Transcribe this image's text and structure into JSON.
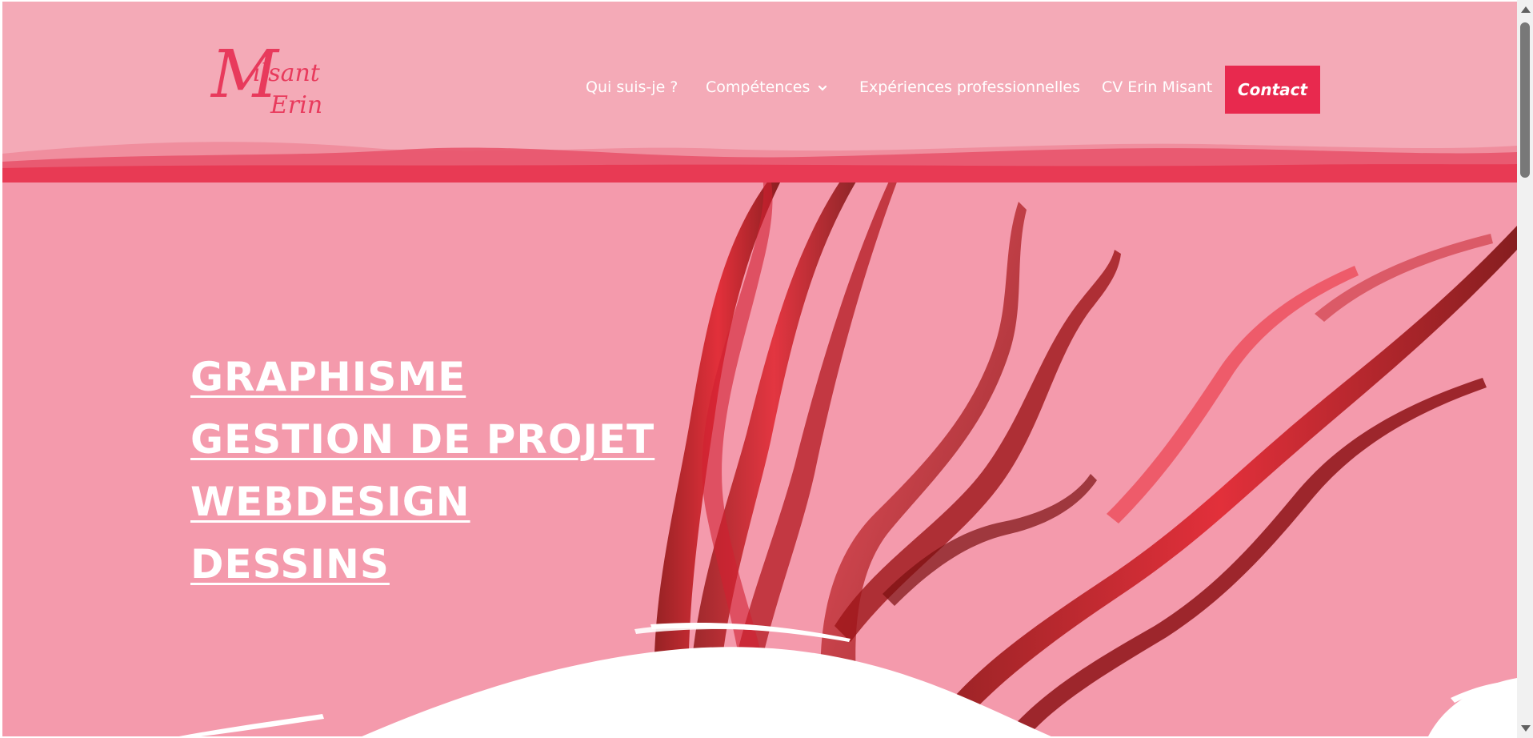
{
  "brand": {
    "logo_initial": "M",
    "logo_top": "ilsant",
    "logo_bottom": "Erin"
  },
  "nav": {
    "items": [
      {
        "label": "Qui suis-je ?"
      },
      {
        "label": "Compétences"
      },
      {
        "label": "Expériences professionnelles"
      },
      {
        "label": "CV Erin Misant"
      }
    ],
    "contact_label": "Contact"
  },
  "hero": {
    "lines": [
      "GRAPHISME",
      "GESTION DE PROJET",
      "WEBDESIGN",
      "DESSINS"
    ]
  },
  "colors": {
    "header_bg": "#f4aab7",
    "hero_bg": "#f49aac",
    "accent": "#e8294e",
    "logo": "#e83a5c"
  }
}
